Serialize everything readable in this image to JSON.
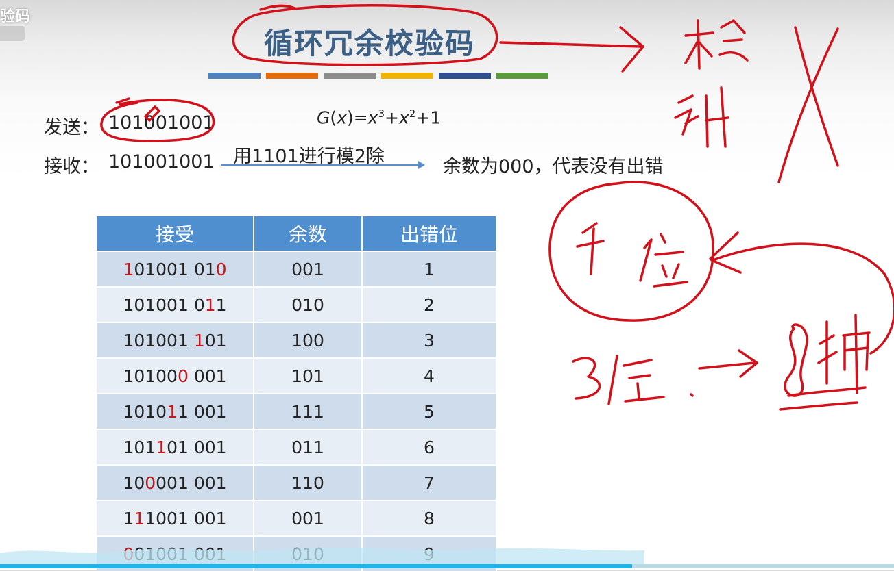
{
  "corner": {
    "label": "验码"
  },
  "slide": {
    "title": "循环冗余校验码",
    "bar_colors": [
      "#4f81bd",
      "#e46c0a",
      "#8c8c8c",
      "#f0b400",
      "#2e4f8f",
      "#5b9b3b"
    ]
  },
  "send": {
    "label": "发送：",
    "value": "101001001"
  },
  "receive": {
    "label": "接收：",
    "value": "101001001"
  },
  "generator": {
    "g": "G",
    "x": "x",
    "eq": ")=",
    "e3": "3",
    "plus": "+",
    "e2": "2",
    "tail": "+1"
  },
  "division": {
    "label": "用1101进行模2除"
  },
  "result": {
    "text": "余数为000，代表没有出错"
  },
  "table": {
    "headers": [
      "接受",
      "余数",
      "出错位"
    ],
    "rows": [
      {
        "received": [
          "",
          "1",
          "01001 01",
          "0",
          ""
        ],
        "remainder": "001",
        "error_bit": "1"
      },
      {
        "received": [
          "101001 0",
          "1",
          "1"
        ],
        "remainder": "010",
        "error_bit": "2"
      },
      {
        "received": [
          "101001 ",
          "1",
          "01"
        ],
        "remainder": "100",
        "error_bit": "3"
      },
      {
        "received": [
          "10100",
          "0",
          " 001"
        ],
        "remainder": "101",
        "error_bit": "4"
      },
      {
        "received": [
          "1010",
          "1",
          "1 001"
        ],
        "remainder": "111",
        "error_bit": "5"
      },
      {
        "received": [
          "101",
          "1",
          "01 001"
        ],
        "remainder": "011",
        "error_bit": "6"
      },
      {
        "received": [
          "10",
          "0",
          "001 001"
        ],
        "remainder": "110",
        "error_bit": "7"
      },
      {
        "received": [
          "1",
          "1",
          "1001 001"
        ],
        "remainder": "001",
        "error_bit": "8"
      },
      {
        "received": [
          "",
          "0",
          "01001 001"
        ],
        "remainder": "010",
        "error_bit": "9"
      }
    ]
  },
  "colors": {
    "accent": "#4f8fd0",
    "ink": "#d2111b",
    "error_bit": "#c0181b",
    "progress": "#20b3e6"
  },
  "player": {
    "progress": 0.707
  }
}
